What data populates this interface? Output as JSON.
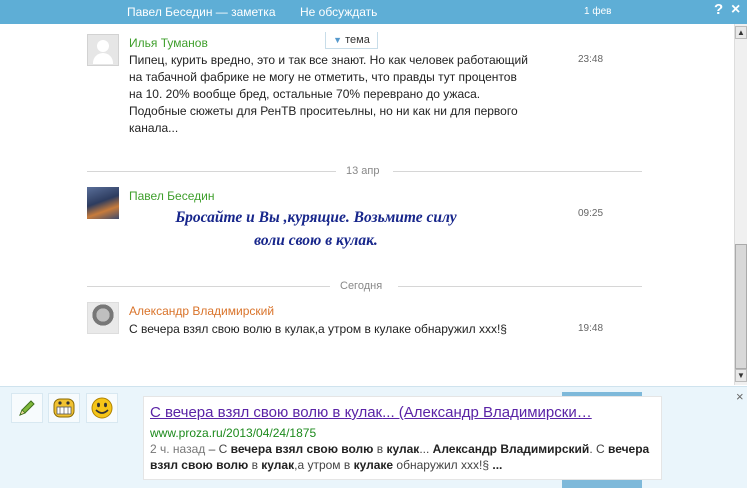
{
  "header": {
    "title": "Павел Беседин — заметка",
    "no_discuss": "Не обсуждать",
    "date": "1 фев",
    "help": "?",
    "close": "×"
  },
  "topic_tab": {
    "arrow": "▼",
    "label": "тема"
  },
  "messages": [
    {
      "author": "Илья Туманов",
      "lines": [
        "Пипец, курить вредно, это и так все знают. Но как человек работающий",
        "на табачной фабрике не могу не отметить, что правды тут процентов",
        "на 10. 20% вообще бред, остальные 70% переврано до ужаса.",
        "Подобные сюжеты для РенТВ  проситеьлны, но ни как ни для первого",
        "канала..."
      ],
      "time": "23:48"
    },
    {
      "author": "Павел Беседин",
      "lines": [
        "Бросайте и Вы ,курящие. Возьмите силу",
        "воли свою в кулак."
      ],
      "time": "09:25"
    },
    {
      "author": "Александр Владимирский",
      "lines": [
        "С вечера взял свою волю в кулак,а утром в кулаке обнаружил ххх!§"
      ],
      "time": "19:48"
    }
  ],
  "separators": [
    "13 апр",
    "Сегодня"
  ],
  "scrollbar": {
    "up": "▲",
    "down": "▼"
  },
  "bottom": {
    "close": "×",
    "tools": [
      "pencil-icon",
      "grin-icon",
      "smile-icon"
    ],
    "result": {
      "title_bold": "С вечера взял свою волю",
      "title_mid": " в ",
      "title_bold2": "кулак",
      "title_rest": "... (Александр Владимирски…",
      "url": "www.proza.ru/2013/04/24/1875",
      "snippet_ago": "2 ч. назад",
      "snippet_dash": " – С ",
      "snippet_b1": "вечера взял свою волю",
      "snippet_t1": " в ",
      "snippet_b2": "кулак",
      "snippet_t2": "... ",
      "snippet_b3": "Александр Владимирский",
      "snippet_t3": ". С ",
      "snippet_b4": "вечера взял свою волю",
      "snippet_t4": " в ",
      "snippet_b5": "кулак",
      "snippet_t5": ",а утром в ",
      "snippet_b6": "кулаке",
      "snippet_t6": " обнаружил ххх!§ ",
      "snippet_b7": "..."
    }
  },
  "colors": {
    "header": "#5eaed6",
    "author_green": "#3f9f2c",
    "author_orange": "#d9732a",
    "fancy_text": "#17268b",
    "result_title": "#5a23a6",
    "result_url": "#1c8a1c"
  }
}
